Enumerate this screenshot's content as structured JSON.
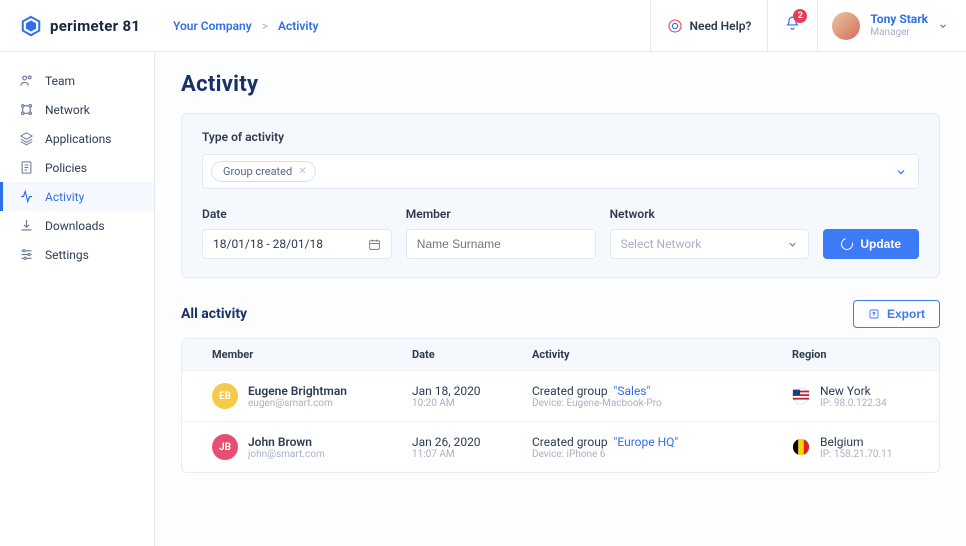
{
  "brand": {
    "name": "perimeter 81"
  },
  "breadcrumb": {
    "root": "Your Company",
    "sep": ">",
    "leaf": "Activity"
  },
  "header": {
    "help": "Need Help?",
    "notifications": "2",
    "user": {
      "name": "Tony Stark",
      "role": "Manager"
    }
  },
  "sidebar": {
    "items": [
      {
        "label": "Team"
      },
      {
        "label": "Network"
      },
      {
        "label": "Applications"
      },
      {
        "label": "Policies"
      },
      {
        "label": "Activity"
      },
      {
        "label": "Downloads"
      },
      {
        "label": "Settings"
      }
    ]
  },
  "page": {
    "title": "Activity",
    "type_label": "Type of activity",
    "chip": "Group created",
    "date_label": "Date",
    "date_value": "18/01/18 - 28/01/18",
    "member_label": "Member",
    "member_placeholder": "Name Surname",
    "network_label": "Network",
    "network_placeholder": "Select Network",
    "update": "Update",
    "all_activity": "All activity",
    "export": "Export",
    "columns": {
      "member": "Member",
      "date": "Date",
      "activity": "Activity",
      "region": "Region"
    }
  },
  "rows": [
    {
      "initials": "EB",
      "badge_color": "#F7C948",
      "name": "Eugene Brightman",
      "email": "eugen@smart.com",
      "date": "Jan 18, 2020",
      "time": "10:20 AM",
      "act_prefix": "Created group",
      "act_group": "\"Sales\"",
      "device_label": "Device:",
      "device": "Eugene-Macbook-Pro",
      "flag": "us",
      "region": "New York",
      "ip_label": "IP:",
      "ip": "98.0.122.34"
    },
    {
      "initials": "JB",
      "badge_color": "#E74E72",
      "name": "John Brown",
      "email": "john@smart.com",
      "date": "Jan 26, 2020",
      "time": "11:07 AM",
      "act_prefix": "Created group",
      "act_group": "\"Europe HQ\"",
      "device_label": "Device:",
      "device": "iPhone 6",
      "flag": "be",
      "region": "Belgium",
      "ip_label": "IP:",
      "ip": "158.21.70.11"
    }
  ]
}
